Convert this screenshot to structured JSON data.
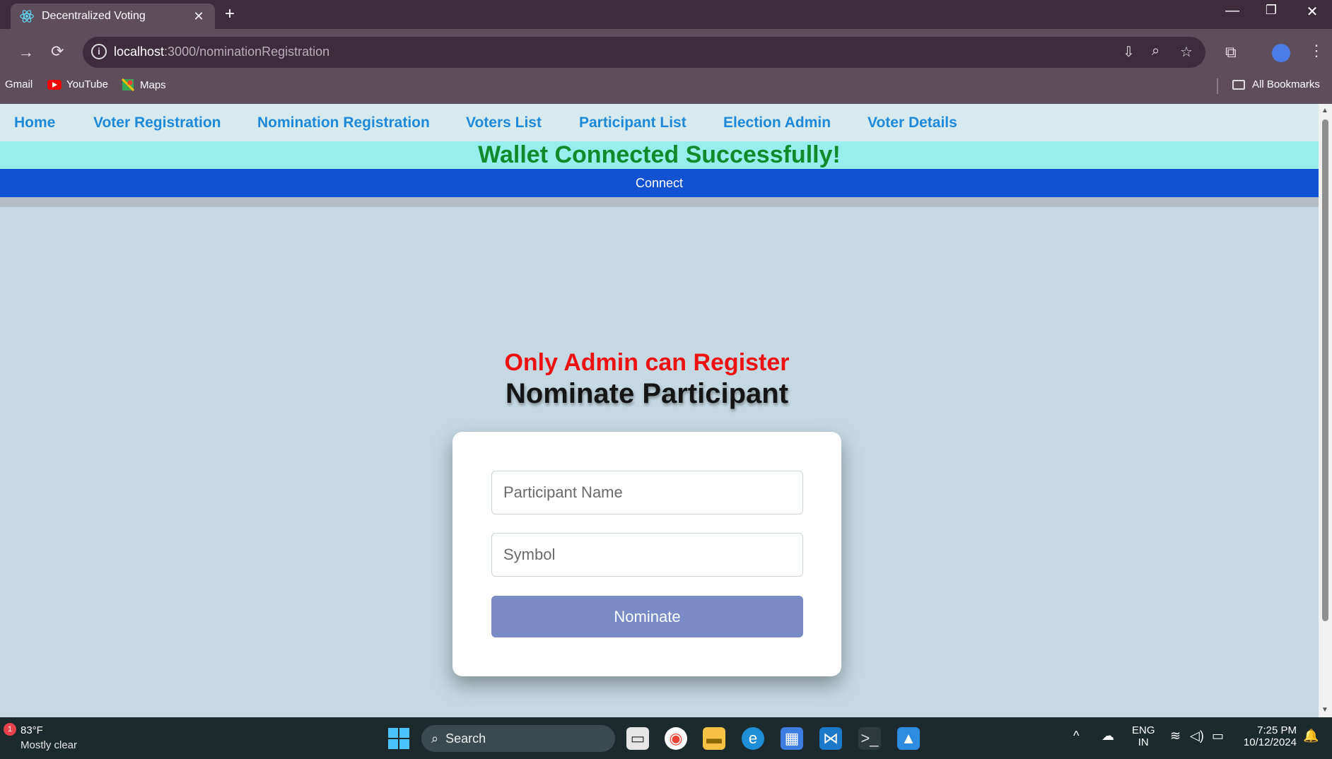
{
  "browser": {
    "tab_title": "Decentralized Voting",
    "url_host": "localhost",
    "url_path": ":3000/nominationRegistration",
    "bookmarks": [
      {
        "label": "Gmail"
      },
      {
        "label": "YouTube"
      },
      {
        "label": "Maps"
      }
    ],
    "all_bookmarks_label": "All Bookmarks"
  },
  "nav": {
    "links": [
      "Home",
      "Voter Registration",
      "Nomination Registration",
      "Voters List",
      "Participant List",
      "Election Admin",
      "Voter Details"
    ]
  },
  "banner": {
    "wallet_status": "Wallet Connected Successfully!",
    "connect_label": "Connect"
  },
  "form": {
    "admin_note": "Only Admin can Register",
    "title": "Nominate Participant",
    "name_placeholder": "Participant Name",
    "symbol_placeholder": "Symbol",
    "submit_label": "Nominate"
  },
  "taskbar": {
    "weather_temp": "83°F",
    "weather_desc": "Mostly clear",
    "weather_badge": "1",
    "search_label": "Search",
    "lang_line1": "ENG",
    "lang_line2": "IN",
    "time": "7:25 PM",
    "date": "10/12/2024"
  },
  "colors": {
    "nav_link": "#1e88d9",
    "wallet_text": "#118a2b",
    "wallet_bg": "#97efed",
    "connect_bg": "#1152d2",
    "admin_note": "#ee1111",
    "nominate_button": "#7b8bc6",
    "page_bg": "#c6d8e2"
  }
}
